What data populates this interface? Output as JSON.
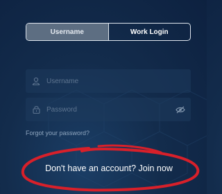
{
  "login_tabs": {
    "username_label": "Username",
    "work_login_label": "Work Login",
    "selected": "Username"
  },
  "form": {
    "username_placeholder": "Username",
    "password_placeholder": "Password"
  },
  "links": {
    "forgot_password": "Forgot your password?",
    "join_now": "Don't have an account? Join now"
  },
  "icons": {
    "username": "user-icon",
    "password": "lock-icon",
    "visibility": "eye-slash-icon"
  },
  "colors": {
    "background": "#132c4c",
    "active_tab": "#5d6e82",
    "annotation_circle": "#d8202a"
  }
}
